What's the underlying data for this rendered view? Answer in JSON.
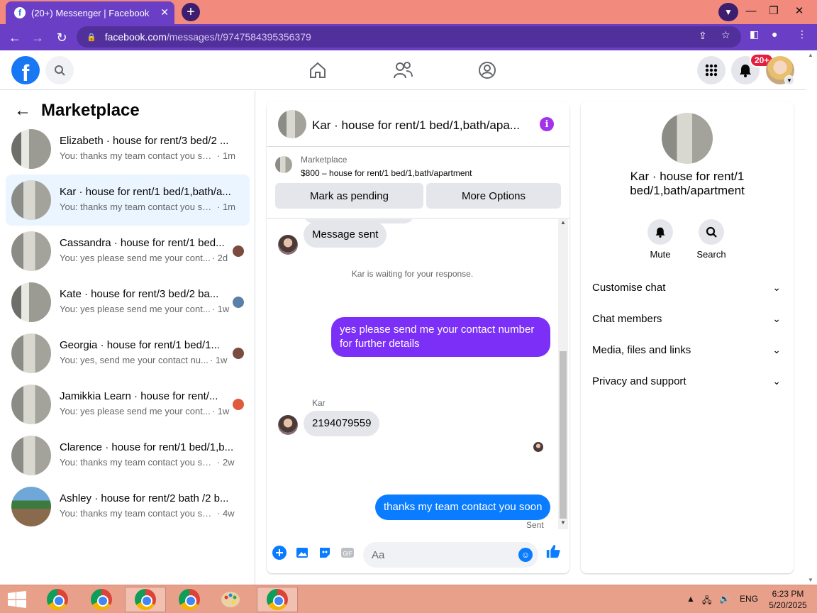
{
  "browser": {
    "tab_title": "(20+) Messenger | Facebook",
    "tab_close": "✕",
    "new_tab": "+",
    "url_host": "facebook.com",
    "url_path": "/messages/t/9747584395356379"
  },
  "header": {
    "notification_badge": "20+"
  },
  "sidebar": {
    "title": "Marketplace",
    "conversations": [
      {
        "title": "Elizabeth · house for rent/3 bed/2 ...",
        "snippet": "You: thanks my team contact you soon",
        "time": "· 1m"
      },
      {
        "title": "Kar · house for rent/1 bed/1,bath/a...",
        "snippet": "You: thanks my team contact you soon",
        "time": "· 1m"
      },
      {
        "title": "Cassandra · house for rent/1 bed...",
        "snippet": "You: yes please send me your cont...",
        "time": "· 2d"
      },
      {
        "title": "Kate · house for rent/3 bed/2 ba...",
        "snippet": "You: yes please send me your cont...",
        "time": "· 1w"
      },
      {
        "title": "Georgia · house for rent/1 bed/1...",
        "snippet": "You: yes, send me your contact nu...",
        "time": "· 1w"
      },
      {
        "title": "Jamikkia Learn · house for rent/...",
        "snippet": "You: yes please send me your cont...",
        "time": "· 1w"
      },
      {
        "title": "Clarence · house for rent/1 bed/1,b...",
        "snippet": "You: thanks my team contact you soon",
        "time": "· 2w"
      },
      {
        "title": "Ashley · house for rent/2 bath /2 b...",
        "snippet": "You: thanks my team contact you soon",
        "time": "· 4w"
      }
    ]
  },
  "chat": {
    "title": "Kar · house for rent/1 bed/1,bath/apa...",
    "listing_kicker": "Marketplace",
    "listing_title": "$800 – house for rent/1 bed/1,bath/apartment",
    "mark_pending": "Mark as pending",
    "more_options": "More Options",
    "messages": {
      "m1": "Message sent",
      "waiting": "Kar is waiting for your response.",
      "m2": "yes please send me your contact number for further details",
      "sender": "Kar",
      "m3": "2194079559",
      "m4": "thanks my team contact you soon",
      "sent": "Sent"
    },
    "composer_placeholder": "Aa"
  },
  "details": {
    "name": "Kar · house for rent/1 bed/1,bath/apartment",
    "mute": "Mute",
    "search": "Search",
    "sections": [
      "Customise chat",
      "Chat members",
      "Media, files and links",
      "Privacy and support"
    ]
  },
  "taskbar": {
    "language": "ENG",
    "time": "6:23 PM",
    "date": "5/20/2025"
  },
  "colors": {
    "facebook_blue": "#1877f2",
    "browser_purple": "#6a3fc6",
    "outgoing_purple": "#7b2ff7",
    "outgoing_blue": "#0a7cff"
  }
}
